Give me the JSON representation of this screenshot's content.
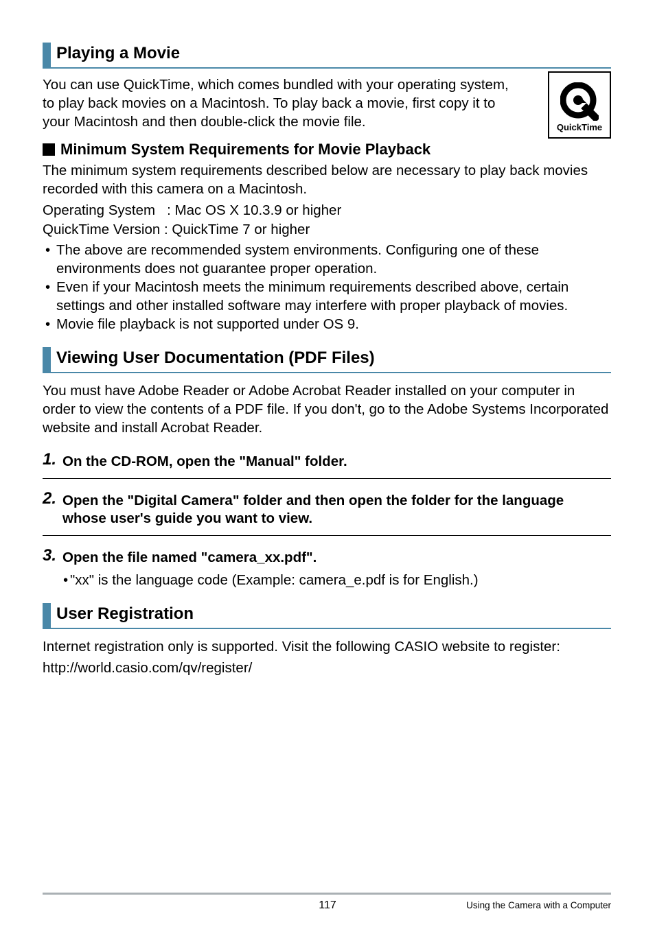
{
  "sections": {
    "playing_movie": {
      "title": "Playing a Movie",
      "intro": "You can use QuickTime, which comes bundled with your operating system, to play back movies on a Macintosh. To play back a movie, first copy it to your Macintosh and then double-click the movie file.",
      "quicktime_label": "QuickTime",
      "subheading": "Minimum System Requirements for Movie Playback",
      "req_intro": "The minimum system requirements described below are necessary to play back movies recorded with this camera on a Macintosh.",
      "os_label": "Operating System",
      "os_sep": ":",
      "os_value": "Mac OS X 10.3.9 or higher",
      "qt_label": "QuickTime Version",
      "qt_sep": ":",
      "qt_value": "QuickTime 7 or higher",
      "bullets": [
        "The above are recommended system environments. Configuring one of these environments does not guarantee proper operation.",
        "Even if your Macintosh meets the minimum requirements described above, certain settings and other installed software may interfere with proper playback of movies.",
        "Movie file playback is not supported under OS 9."
      ]
    },
    "viewing_docs": {
      "title": "Viewing User Documentation (PDF Files)",
      "intro": "You must have Adobe Reader or Adobe Acrobat Reader installed on your computer in order to view the contents of a PDF file. If you don't, go to the Adobe Systems Incorporated website and install Acrobat Reader.",
      "steps": [
        {
          "num": "1.",
          "text": "On the CD-ROM, open the \"Manual\" folder."
        },
        {
          "num": "2.",
          "text": "Open the \"Digital Camera\" folder and then open the folder for the language whose user's guide you want to view."
        },
        {
          "num": "3.",
          "text": "Open the file named \"camera_xx.pdf\"."
        }
      ],
      "step3_note": "\"xx\" is the language code (Example: camera_e.pdf is for English.)"
    },
    "user_registration": {
      "title": "User Registration",
      "body": "Internet registration only is supported. Visit the following CASIO website to register:",
      "url": "http://world.casio.com/qv/register/"
    }
  },
  "footer": {
    "page_number": "117",
    "right_text": "Using the Camera with a Computer"
  }
}
